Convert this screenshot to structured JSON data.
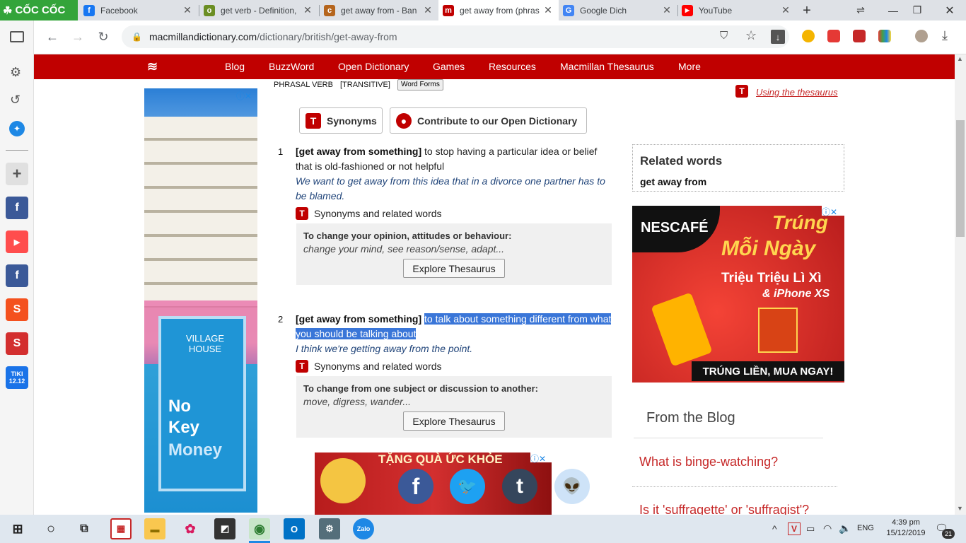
{
  "browser": {
    "brand": "CỐC CỐC",
    "tabs": [
      {
        "title": "Facebook",
        "color": "#1877f2",
        "glyph": "f"
      },
      {
        "title": "get verb - Definition,",
        "color": "#6b8e23",
        "glyph": "o"
      },
      {
        "title": "get away from - Ban",
        "color": "#b5651d",
        "glyph": "c"
      },
      {
        "title": "get away from (phras",
        "color": "#c00000",
        "glyph": "m"
      },
      {
        "title": "Google Dich",
        "color": "#4285f4",
        "glyph": "G"
      },
      {
        "title": "YouTube",
        "color": "#ff0000",
        "glyph": "▶"
      }
    ],
    "new_tab": "+",
    "url_host": "macmillandictionary.com",
    "url_path": "/dictionary/british/get-away-from"
  },
  "site": {
    "nav": [
      "Blog",
      "BuzzWord",
      "Open Dictionary",
      "Games",
      "Resources",
      "Macmillan Thesaurus",
      "More"
    ],
    "phrasal_verb": "PHRASAL VERB",
    "transitive": "[TRANSITIVE]",
    "word_forms": "Word Forms",
    "using_thesaurus": "Using the thesaurus",
    "synonyms_btn": "Synonyms",
    "contribute_btn": "Contribute to our Open Dictionary"
  },
  "senses": [
    {
      "num": "1",
      "phrase": "[get away from something]",
      "definition": " to stop having a particular idea or belief that is old-fashioned or not helpful",
      "example": "We want to get away from this idea that in a divorce one partner has to be blamed.",
      "syn_label": "Synonyms and related words",
      "th_head": "To change your opinion, attitudes or behaviour:",
      "th_list": "change your mind, see reason/sense, adapt...",
      "explore": "Explore Thesaurus"
    },
    {
      "num": "2",
      "phrase": "[get away from something]",
      "definition_a": "to talk about something different from what",
      "definition_b": "you should be talking about",
      "example": "I think we're getting away from the point.",
      "syn_label": "Synonyms and related words",
      "th_head": "To change from one subject or discussion to another:",
      "th_list": "move, digress, wander...",
      "explore": "Explore Thesaurus"
    }
  ],
  "related": {
    "title": "Related words",
    "item": "get away from"
  },
  "ads": {
    "left": {
      "brand": "VILLAGE HOUSE",
      "line1": "No",
      "line2": "Key",
      "line3": "Money"
    },
    "right": {
      "brand": "NESCAFÉ",
      "line1": "Trúng",
      "line2": "Mỗi Ngày",
      "line3": "Triệu Triệu Lì Xì",
      "line4": "& iPhone XS",
      "footer": "TRÚNG LIỀN, MUA NGAY!"
    },
    "bottom": {
      "text": "TẶNG QUÀ ỨC KHỎE"
    }
  },
  "blog": {
    "title": "From the Blog",
    "items": [
      "What is binge-watching?",
      "Is it 'suffragette' or 'suffragist'?"
    ]
  },
  "taskbar": {
    "language": "ENG",
    "time": "4:39 pm",
    "date": "15/12/2019",
    "notifications": "21"
  }
}
